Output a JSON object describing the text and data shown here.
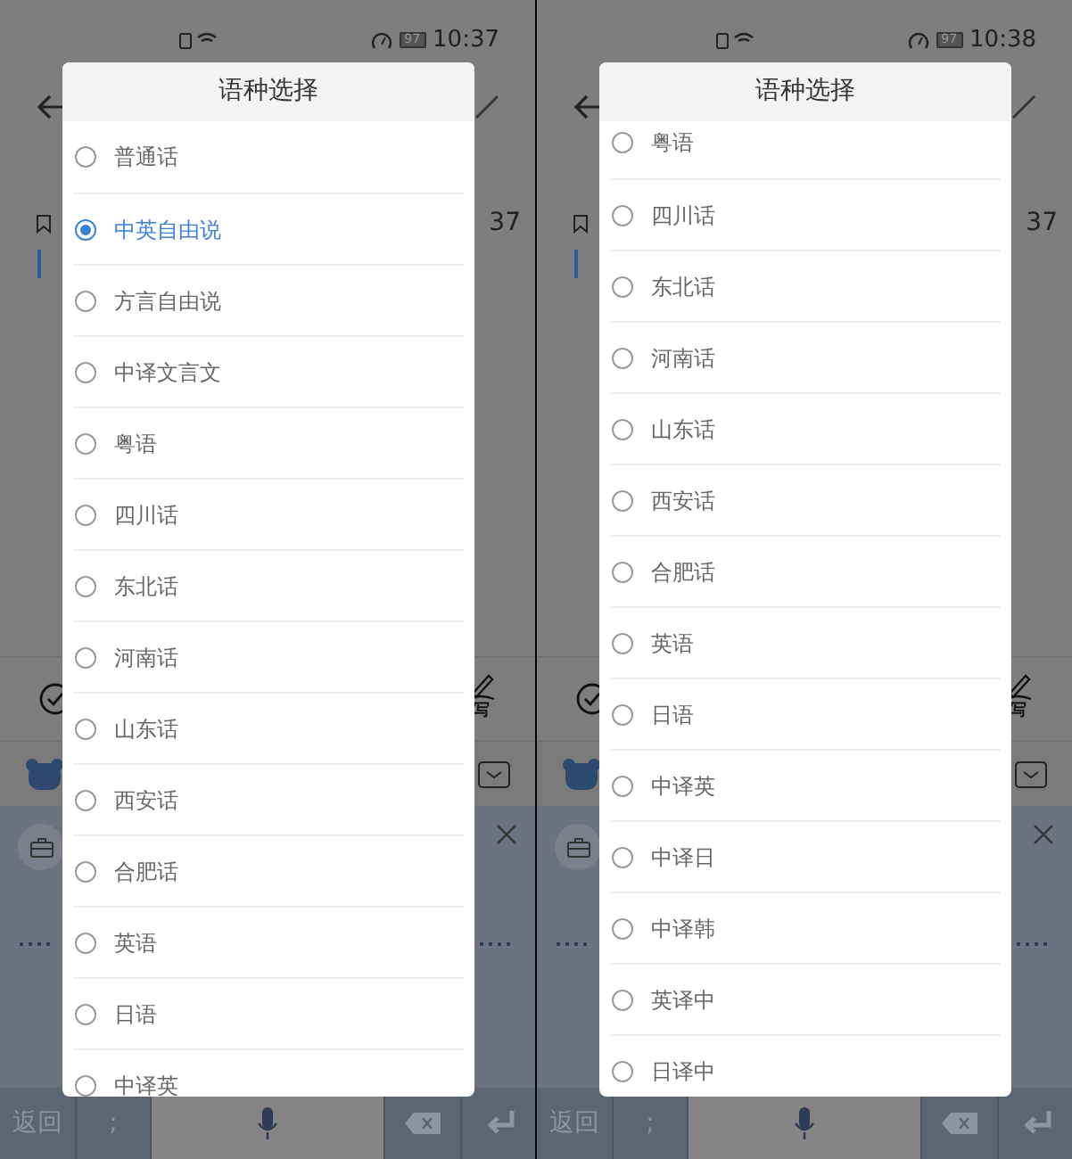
{
  "panels": [
    {
      "status_bar": {
        "battery": "97",
        "time": "10:37"
      },
      "background": {
        "count": "37",
        "toolbar_label": "写"
      },
      "dialog": {
        "title": "语种选择",
        "scrolled": false,
        "options": [
          {
            "label": "普通话",
            "selected": false
          },
          {
            "label": "中英自由说",
            "selected": true
          },
          {
            "label": "方言自由说",
            "selected": false
          },
          {
            "label": "中译文言文",
            "selected": false
          },
          {
            "label": "粤语",
            "selected": false
          },
          {
            "label": "四川话",
            "selected": false
          },
          {
            "label": "东北话",
            "selected": false
          },
          {
            "label": "河南话",
            "selected": false
          },
          {
            "label": "山东话",
            "selected": false
          },
          {
            "label": "西安话",
            "selected": false
          },
          {
            "label": "合肥话",
            "selected": false
          },
          {
            "label": "英语",
            "selected": false
          },
          {
            "label": "日语",
            "selected": false
          },
          {
            "label": "中译英",
            "selected": false
          }
        ]
      },
      "keyboard": {
        "back_key": "返回",
        "punct_key": ";"
      }
    },
    {
      "status_bar": {
        "battery": "97",
        "time": "10:38"
      },
      "background": {
        "count": "37",
        "toolbar_label": "写"
      },
      "dialog": {
        "title": "语种选择",
        "scrolled": true,
        "options": [
          {
            "label": "粤语",
            "selected": false
          },
          {
            "label": "四川话",
            "selected": false
          },
          {
            "label": "东北话",
            "selected": false
          },
          {
            "label": "河南话",
            "selected": false
          },
          {
            "label": "山东话",
            "selected": false
          },
          {
            "label": "西安话",
            "selected": false
          },
          {
            "label": "合肥话",
            "selected": false
          },
          {
            "label": "英语",
            "selected": false
          },
          {
            "label": "日语",
            "selected": false
          },
          {
            "label": "中译英",
            "selected": false
          },
          {
            "label": "中译日",
            "selected": false
          },
          {
            "label": "中译韩",
            "selected": false
          },
          {
            "label": "英译中",
            "selected": false
          },
          {
            "label": "日译中",
            "selected": false
          }
        ]
      },
      "keyboard": {
        "back_key": "返回",
        "punct_key": ";"
      }
    }
  ]
}
